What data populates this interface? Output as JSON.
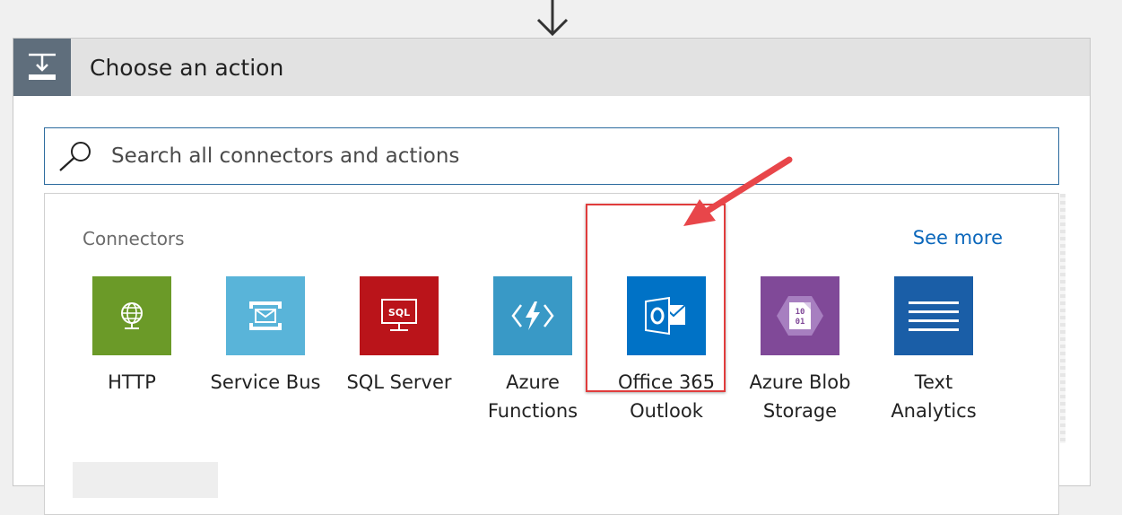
{
  "header": {
    "title": "Choose an action",
    "icon": "download-step-icon"
  },
  "search": {
    "placeholder": "Search all connectors and actions",
    "value": "",
    "icon": "search-icon"
  },
  "connectors": {
    "heading": "Connectors",
    "see_more": "See more",
    "items": [
      {
        "label": "HTTP",
        "icon": "globe-icon",
        "color": "#6b9a28"
      },
      {
        "label": "Service Bus",
        "icon": "service-bus-icon",
        "color": "#59b4d9"
      },
      {
        "label": "SQL Server",
        "icon": "sql-icon",
        "color": "#ba141a"
      },
      {
        "label": "Azure\nFunctions",
        "icon": "azure-functions-icon",
        "color": "#3999c6"
      },
      {
        "label": "Office 365\nOutlook",
        "icon": "outlook-icon",
        "color": "#0072c6"
      },
      {
        "label": "Azure Blob\nStorage",
        "icon": "blob-storage-icon",
        "color": "#804998"
      },
      {
        "label": "Text\nAnalytics",
        "icon": "text-lines-icon",
        "color": "#1a5ea7"
      }
    ]
  },
  "annotation": {
    "highlight_color": "#e03c3c"
  }
}
